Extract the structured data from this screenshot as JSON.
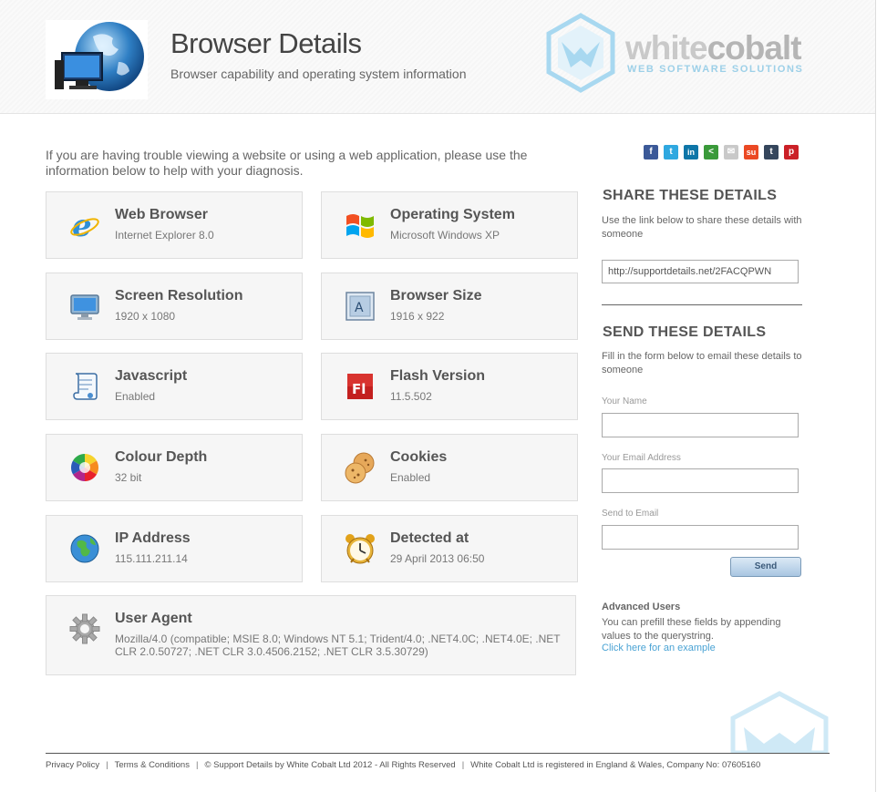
{
  "header": {
    "title": "Browser Details",
    "subtitle": "Browser capability and operating system information",
    "brand_part1": "white",
    "brand_part2": "cobalt",
    "brand_tagline": "WEB SOFTWARE SOLUTIONS"
  },
  "intro": "If you are having trouble viewing a website or using a web application, please use the information below to help with your diagnosis.",
  "cards": {
    "web_browser": {
      "title": "Web Browser",
      "value": "Internet Explorer 8.0",
      "icon": "ie-icon"
    },
    "operating_system": {
      "title": "Operating System",
      "value": "Microsoft Windows XP",
      "icon": "windows-icon"
    },
    "screen_resolution": {
      "title": "Screen Resolution",
      "value": "1920 x 1080",
      "icon": "monitor-icon"
    },
    "browser_size": {
      "title": "Browser Size",
      "value": "1916 x 922",
      "icon": "window-size-icon"
    },
    "javascript": {
      "title": "Javascript",
      "value": "Enabled",
      "icon": "script-icon"
    },
    "flash_version": {
      "title": "Flash Version",
      "value": "11.5.502",
      "icon": "flash-icon"
    },
    "colour_depth": {
      "title": "Colour Depth",
      "value": "32 bit",
      "icon": "color-wheel-icon"
    },
    "cookies": {
      "title": "Cookies",
      "value": "Enabled",
      "icon": "cookie-icon"
    },
    "ip_address": {
      "title": "IP Address",
      "value": "115.111.211.14",
      "icon": "globe-icon"
    },
    "detected_at": {
      "title": "Detected at",
      "value": "29 April 2013 06:50",
      "icon": "alarm-clock-icon"
    },
    "user_agent": {
      "title": "User Agent",
      "value": "Mozilla/4.0 (compatible; MSIE 8.0; Windows NT 5.1; Trident/4.0; .NET4.0C; .NET4.0E; .NET CLR 2.0.50727; .NET CLR 3.0.4506.2152; .NET CLR 3.5.30729)",
      "icon": "gear-icon"
    }
  },
  "share_icons": [
    {
      "name": "facebook-icon",
      "glyph": "f",
      "color": "#3b5998"
    },
    {
      "name": "twitter-icon",
      "glyph": "t",
      "color": "#2fa8e0"
    },
    {
      "name": "linkedin-icon",
      "glyph": "in",
      "color": "#0e76a8"
    },
    {
      "name": "share-icon",
      "glyph": "<",
      "color": "#3a9a3a"
    },
    {
      "name": "email-icon",
      "glyph": "✉",
      "color": "#c9c9c9"
    },
    {
      "name": "stumbleupon-icon",
      "glyph": "su",
      "color": "#eb4924"
    },
    {
      "name": "tumblr-icon",
      "glyph": "t",
      "color": "#35465c"
    },
    {
      "name": "pinterest-icon",
      "glyph": "p",
      "color": "#cb2027"
    }
  ],
  "share": {
    "heading": "SHARE THESE DETAILS",
    "text": "Use the link below to share these details with someone",
    "link": "http://supportdetails.net/2FACQPWN"
  },
  "send": {
    "heading": "SEND THESE DETAILS",
    "text": "Fill in the form below to email these details to someone",
    "name_label": "Your Name",
    "email_label": "Your Email Address",
    "to_label": "Send to Email",
    "button": "Send"
  },
  "advanced": {
    "title": "Advanced Users",
    "text": "You can prefill these fields by appending values to the querystring.",
    "link": "Click here for an example"
  },
  "footer": {
    "privacy": "Privacy Policy",
    "terms": "Terms & Conditions",
    "copyright": "© Support Details by White Cobalt Ltd 2012 - All Rights Reserved",
    "company": "White Cobalt Ltd is registered in England & Wales, Company No: 07605160",
    "separator": "|"
  },
  "colors": {
    "accent": "#4aa3d4",
    "brand_blue": "#9dd0e8",
    "card_bg": "#f6f6f6"
  }
}
